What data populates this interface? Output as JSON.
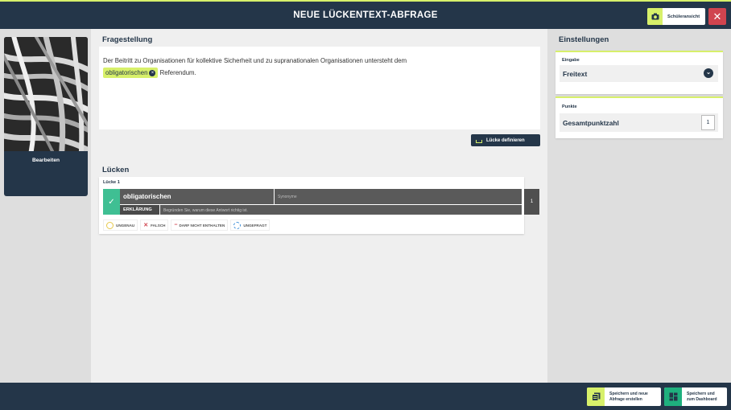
{
  "header": {
    "title": "NEUE LÜCKENTEXT-ABFRAGE",
    "student_view_label": "Schüleransicht",
    "close_glyph": "✕"
  },
  "left": {
    "edit_label": "Bearbeiten"
  },
  "question": {
    "section_title": "Fragestellung",
    "text_part1": "Der Beitritt zu Organisationen für kollektive Sicherheit und zu supranationalen Organisationen untersteht dem",
    "gap_word": "obligatorischen",
    "text_part2": "Referendum.",
    "define_gap_label": "Lücke definieren"
  },
  "gaps": {
    "section_title": "Lücken",
    "items": [
      {
        "title": "Lücke 1",
        "answer": "obligatorischen",
        "synonyms_placeholder": "Synonyme",
        "explanation_label": "ERKLÄRUNG",
        "explanation_placeholder": "Begründen Sie, warum diese Antwort richtig ist.",
        "badge": "1",
        "options": [
          "UNGENAU",
          "FALSCH",
          "DARF NICHT ENTHALTEN",
          "UNGEFRAGT"
        ]
      }
    ]
  },
  "settings": {
    "section_title": "Einstellungen",
    "input_label": "Eingabe",
    "input_value": "Freitext",
    "points_label": "Punkte",
    "points_field": "Gesamtpunktzahl",
    "points_value": "1"
  },
  "footer": {
    "save_new_line1": "Speichern und neue",
    "save_new_line2": "Abfrage erstellen",
    "save_dash_line1": "Speichern und",
    "save_dash_line2": "zum Dashboard"
  },
  "colors": {
    "navy": "#243649",
    "accent": "#d7f06a",
    "danger": "#d0444f",
    "correct": "#3fbf93",
    "dashboard_icon": "#1fb07e"
  }
}
